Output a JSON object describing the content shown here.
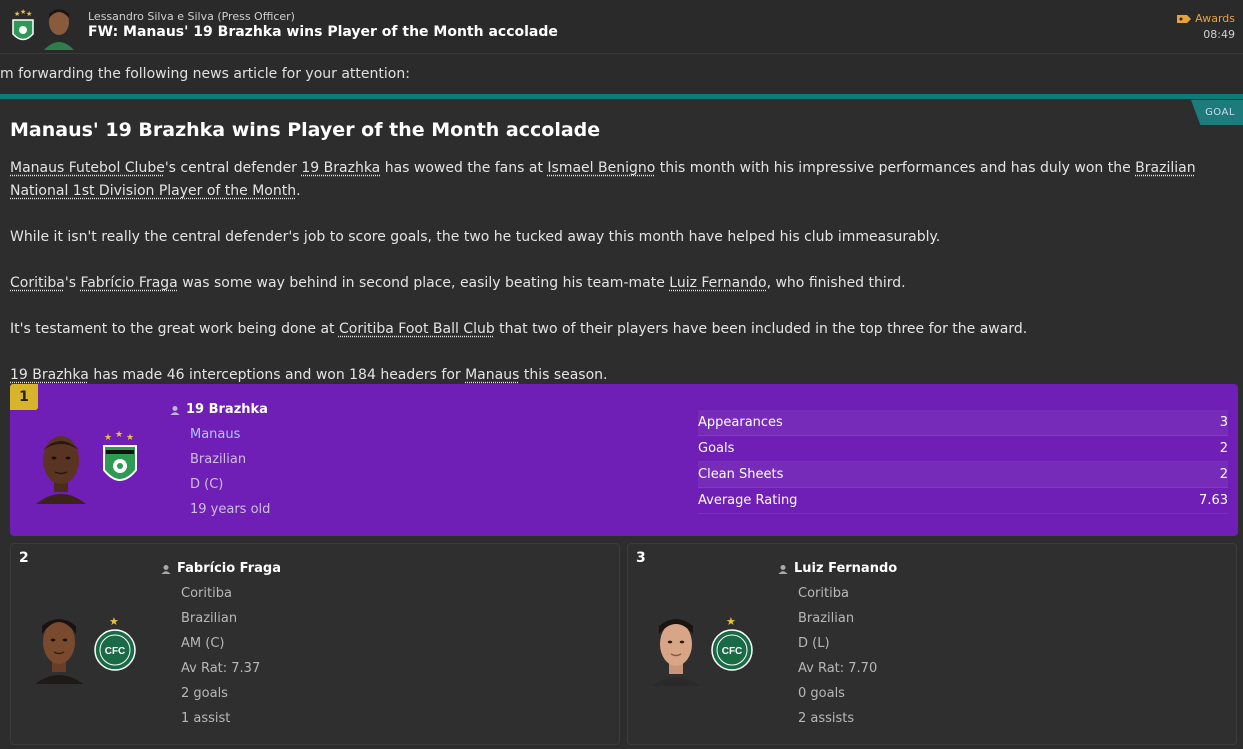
{
  "header": {
    "sender": "Lessandro Silva e Silva  (Press Officer)",
    "subject": "FW: Manaus' 19 Brazhka wins Player of the Month accolade",
    "category": "Awards",
    "time": "08:49",
    "accent_color": "#e8a23a"
  },
  "intro": "m forwarding the following news article for your attention:",
  "article": {
    "tag": "GOAL",
    "headline": "Manaus' 19 Brazhka wins Player of the Month accolade",
    "p1": {
      "club": "Manaus Futebol Clube",
      "t1": "'s central defender ",
      "player": "19 Brazhka",
      "t2": " has wowed the fans at ",
      "stadium": "Ismael Benigno",
      "t3": " this month with his impressive performances and has duly won the ",
      "award": "Brazilian National 1st Division Player of the Month",
      "t4": "."
    },
    "p2": "While it isn't really the central defender's job to score goals, the two he tucked away this month have helped his club immeasurably.",
    "p3": {
      "club": "Coritiba",
      "t1": "'s ",
      "player": "Fabrício Fraga",
      "t2": " was some way behind in second place, easily beating his team-mate ",
      "mate": "Luiz Fernando",
      "t3": ", who finished third."
    },
    "p4": {
      "t1": "It's testament to the great work being done at ",
      "club": "Coritiba Foot Ball Club",
      "t2": " that two of their players have been included in the top three for the award."
    },
    "p5": {
      "player": "19 Brazhka",
      "t1": " has made 46 interceptions and won 184 headers for ",
      "club": "Manaus",
      "t2": " this season."
    }
  },
  "winner": {
    "rank": "1",
    "name": "19 Brazhka",
    "club": "Manaus",
    "nationality": "Brazilian",
    "position": "D (C)",
    "age": "19 years old",
    "stats": [
      {
        "label": "Appearances",
        "value": "3"
      },
      {
        "label": "Goals",
        "value": "2"
      },
      {
        "label": "Clean Sheets",
        "value": "2"
      },
      {
        "label": "Average Rating",
        "value": "7.63"
      }
    ],
    "card_color": "#6f1fb5"
  },
  "second": {
    "rank": "2",
    "name": "Fabrício Fraga",
    "club": "Coritiba",
    "nationality": "Brazilian",
    "position": "AM (C)",
    "rating": "Av Rat: 7.37",
    "goals": "2 goals",
    "assists": "1 assist"
  },
  "third": {
    "rank": "3",
    "name": "Luiz Fernando",
    "club": "Coritiba",
    "nationality": "Brazilian",
    "position": "D (L)",
    "rating": "Av Rat: 7.70",
    "goals": "0 goals",
    "assists": "2 assists"
  }
}
